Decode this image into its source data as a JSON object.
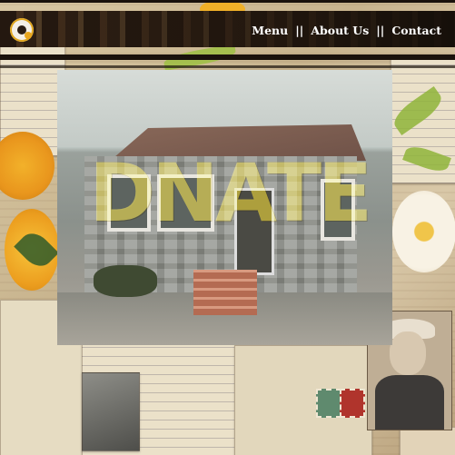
{
  "nav": {
    "items": [
      {
        "label": "Menu"
      },
      {
        "label": "About Us"
      },
      {
        "label": "Contact"
      }
    ],
    "separator": "||"
  },
  "hero": {
    "overlay_text": "DNATE"
  },
  "colors": {
    "nav_text": "#ffffff",
    "topbar": "#2e2118",
    "accent": "#e8a51d"
  },
  "icons": {
    "logo": "round-logo-icon"
  }
}
